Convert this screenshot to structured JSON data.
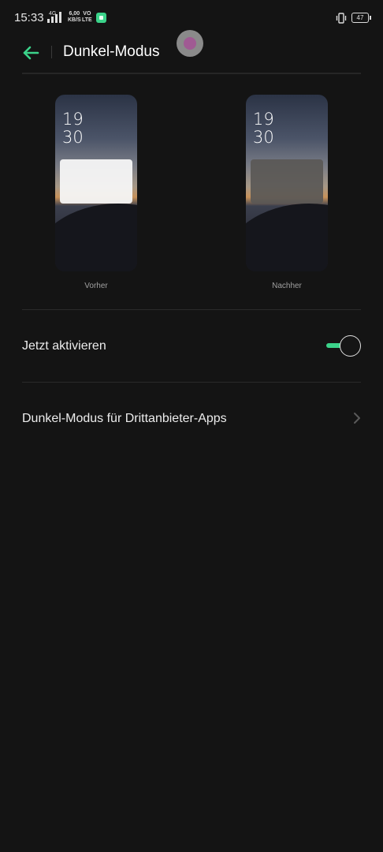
{
  "status_bar": {
    "time": "15:33",
    "network": "4G",
    "speed_value": "6,00",
    "speed_unit": "KB/S",
    "volte_top": "VO",
    "volte_bottom": "LTE",
    "battery": "47"
  },
  "header": {
    "title": "Dunkel-Modus",
    "back_icon": "arrow-left-icon"
  },
  "previews": {
    "before": {
      "time_hour": "19",
      "time_minute": "30",
      "label": "Vorher"
    },
    "after": {
      "time_hour": "19",
      "time_minute": "30",
      "label": "Nachher"
    }
  },
  "settings": {
    "activate_label": "Jetzt aktivieren",
    "activate_on": true,
    "third_party_label": "Dunkel-Modus für Drittanbieter-Apps"
  },
  "colors": {
    "accent": "#3bd38a",
    "background": "#141414"
  }
}
